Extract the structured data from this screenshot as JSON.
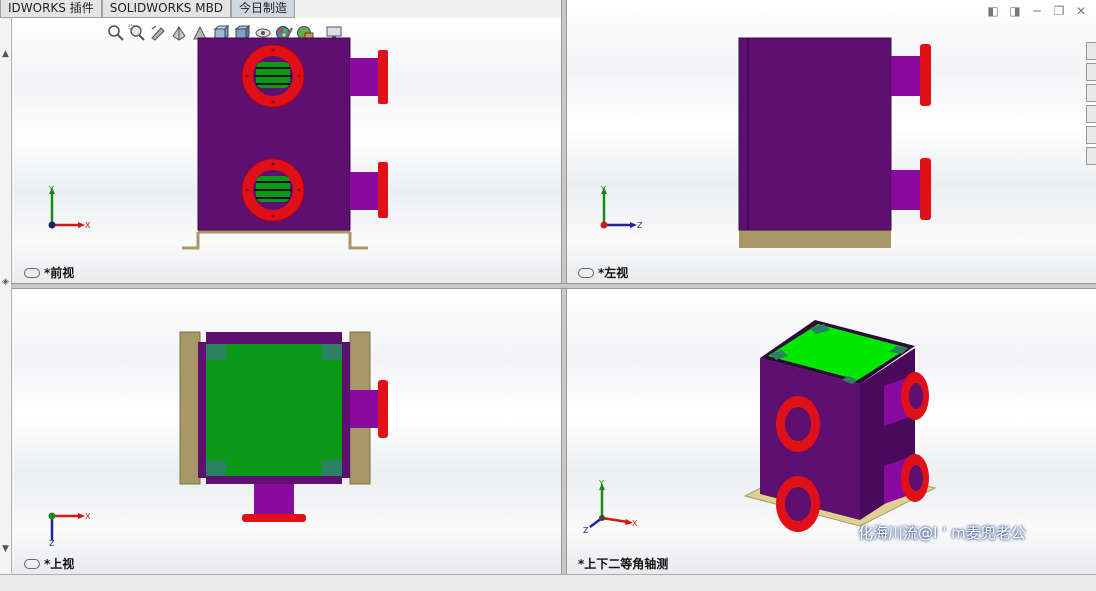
{
  "tabs": [
    {
      "label": "IDWORKS 插件",
      "active": false
    },
    {
      "label": "SOLIDWORKS MBD",
      "active": false
    },
    {
      "label": "今日制造",
      "active": true
    }
  ],
  "view_toolbar": {
    "icons": [
      "zoom-to-fit-icon",
      "zoom-to-area-icon",
      "previous-view-icon",
      "section-view-icon",
      "dynamic-annotation-icon",
      "view-orientation-icon",
      "display-style-icon",
      "hide-show-items-icon",
      "edit-appearance-icon",
      "apply-scene-icon",
      "view-settings-icon"
    ]
  },
  "viewports": {
    "front": {
      "label": "*前视",
      "axes": [
        "Y",
        "X"
      ]
    },
    "left": {
      "label": "*左视",
      "axes": [
        "Y",
        "Z"
      ]
    },
    "top": {
      "label": "*上视",
      "axes": [
        "Z",
        "X"
      ]
    },
    "iso": {
      "label": "*上下二等角轴测",
      "axes": [
        "Y",
        "X",
        "Z"
      ]
    }
  },
  "watermark": "化海川流@I ' m麦兜老公",
  "colors": {
    "body": "#5e1070",
    "body_dark": "#3d0a4a",
    "flange": "#e01018",
    "pipe": "#8a0aa0",
    "top_plate": "#00c800",
    "base": "#a89868",
    "inner_green": "#0a9a18"
  }
}
